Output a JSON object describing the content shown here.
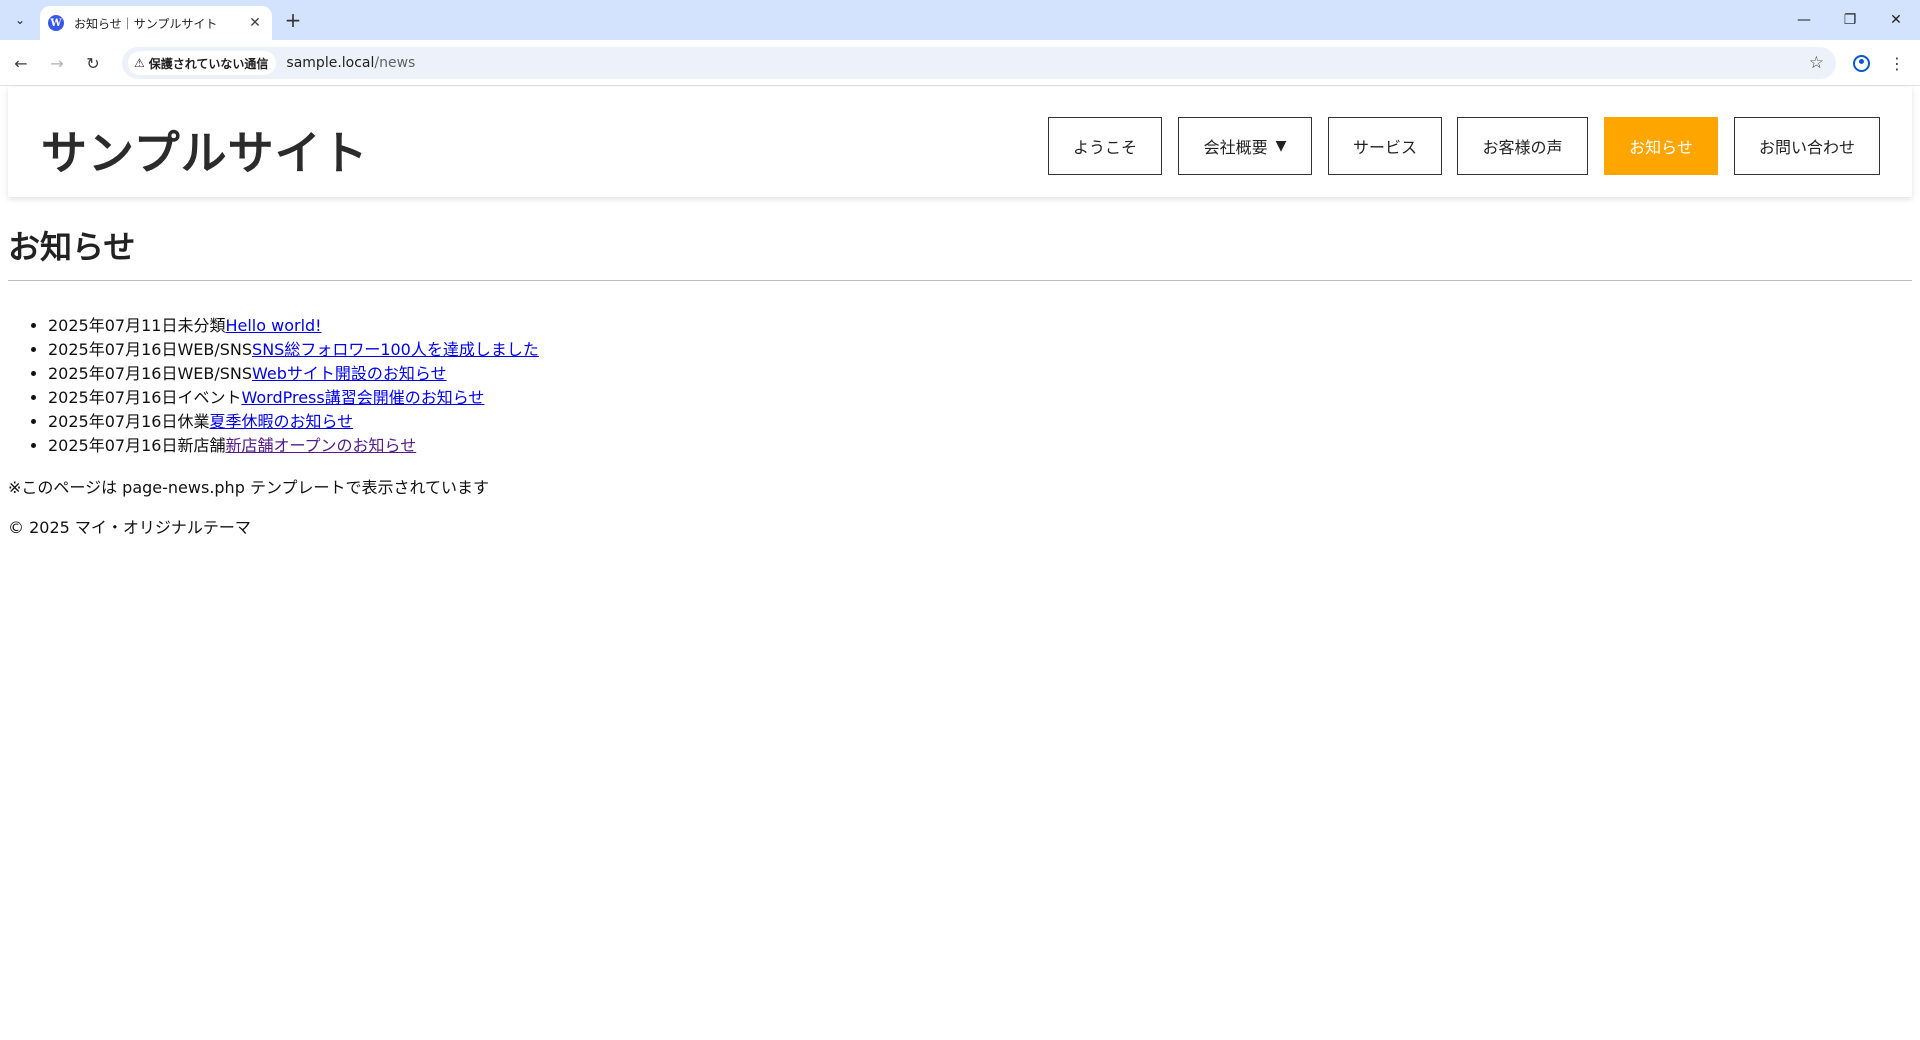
{
  "browser": {
    "tab_title": "お知らせ｜サンプルサイト",
    "security_label": "保護されていない通信",
    "url_host": "sample.local",
    "url_path": "/news",
    "icons": {
      "tab_search": "chevron-down-icon",
      "favicon": "wordpress-icon",
      "close": "close-icon",
      "new_tab": "plus-icon",
      "back": "arrow-left-icon",
      "forward": "arrow-right-icon",
      "reload": "reload-icon",
      "warning": "warning-icon",
      "bookmark": "star-icon",
      "profile": "profile-icon",
      "menu": "kebab-menu-icon"
    }
  },
  "site": {
    "title": "サンプルサイト",
    "nav": [
      {
        "label": "ようこそ",
        "active": false
      },
      {
        "label": "会社概要",
        "active": false,
        "has_dropdown": true
      },
      {
        "label": "サービス",
        "active": false
      },
      {
        "label": "お客様の声",
        "active": false
      },
      {
        "label": "お知らせ",
        "active": true
      },
      {
        "label": "お問い合わせ",
        "active": false
      }
    ],
    "accent_color": "#ffa500"
  },
  "main": {
    "heading": "お知らせ",
    "news": [
      {
        "date": "2025年07月11日",
        "category": "未分類",
        "title": "Hello world!"
      },
      {
        "date": "2025年07月16日",
        "category": "WEB/SNS",
        "title": "SNS総フォロワー100人を達成しました"
      },
      {
        "date": "2025年07月16日",
        "category": "WEB/SNS",
        "title": "Webサイト開設のお知らせ"
      },
      {
        "date": "2025年07月16日",
        "category": "イベント",
        "title": "WordPress講習会開催のお知らせ"
      },
      {
        "date": "2025年07月16日",
        "category": "休業",
        "title": "夏季休暇のお知らせ"
      },
      {
        "date": "2025年07月16日",
        "category": "新店舗",
        "title": "新店舗オープンのお知らせ",
        "visited": true
      }
    ],
    "note": "※このページは page-news.php テンプレートで表示されています"
  },
  "footer": {
    "copyright": "© 2025 マイ・オリジナルテーマ"
  }
}
